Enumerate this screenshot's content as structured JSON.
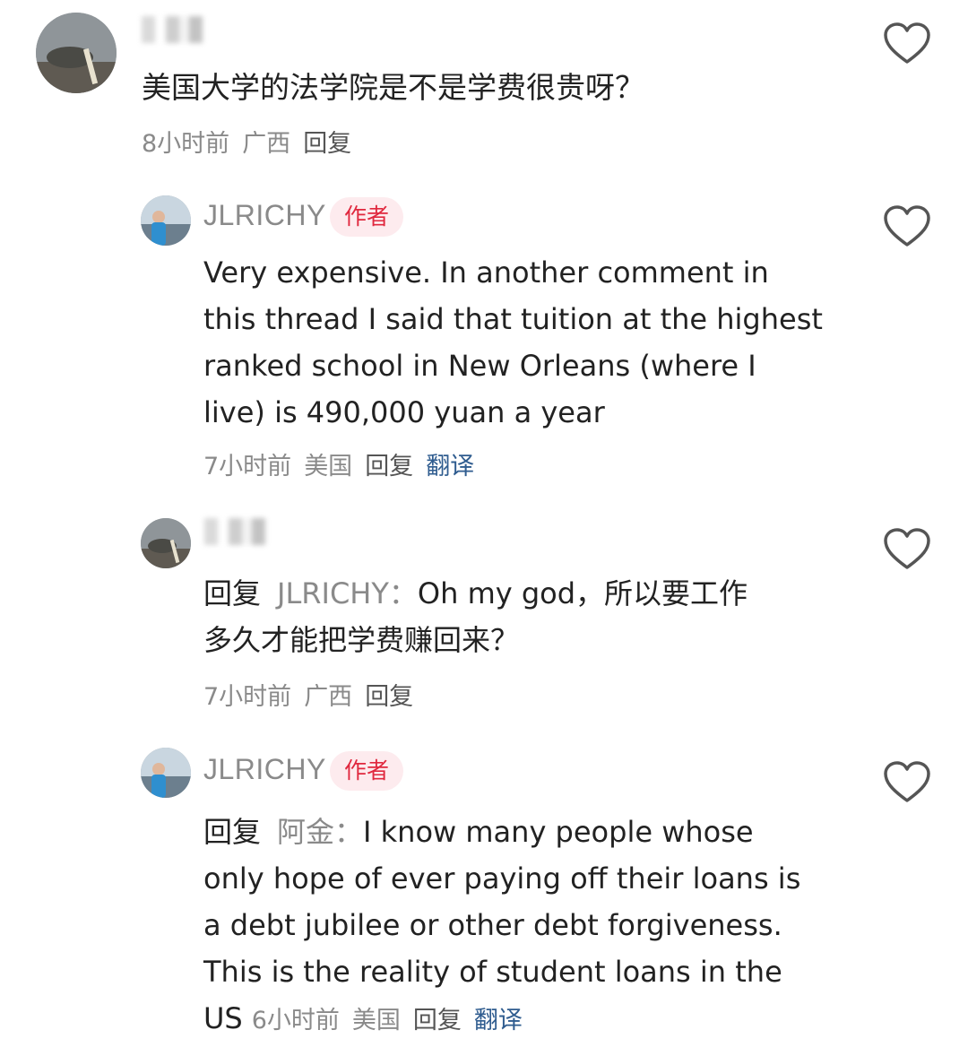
{
  "comments": [
    {
      "username": "",
      "text": "美国大学的法学院是不是学费很贵呀？",
      "time": "8小时前",
      "location": "广西",
      "reply_label": "回复"
    },
    {
      "username": "JLRICHY",
      "badge": "作者",
      "text_lines": [
        "Very expensive. In another comment in",
        "this thread I said that tuition at the highest",
        "ranked school in New Orleans (where I",
        "live) is 490,000 yuan a year"
      ],
      "time": "7小时前",
      "location": "美国",
      "reply_label": "回复",
      "translate_label": "翻译"
    },
    {
      "username": "",
      "reply_prefix": "回复",
      "reply_target": "JLRICHY：",
      "text_line1": "Oh my god，所以要工作",
      "text_line2": "多久才能把学费赚回来？",
      "time": "7小时前",
      "location": "广西",
      "reply_label": "回复"
    },
    {
      "username": "JLRICHY",
      "badge": "作者",
      "reply_prefix": "回复",
      "reply_target": "阿金：",
      "text_line1": "I know many people whose",
      "text_lines_rest": [
        "only hope of ever paying off their loans is",
        "a debt jubilee or other debt forgiveness.",
        "This is the reality of student loans in the"
      ],
      "text_last": "US",
      "time": "6小时前",
      "location": "美国",
      "reply_label": "回复",
      "translate_label": "翻译"
    }
  ],
  "icons": {
    "like": "heart-outline-icon"
  },
  "colors": {
    "author_badge_bg": "#fdebee",
    "author_badge_text": "#e0283e",
    "translate_link": "#2f5c8f",
    "meta_text": "#8a8a8a"
  }
}
